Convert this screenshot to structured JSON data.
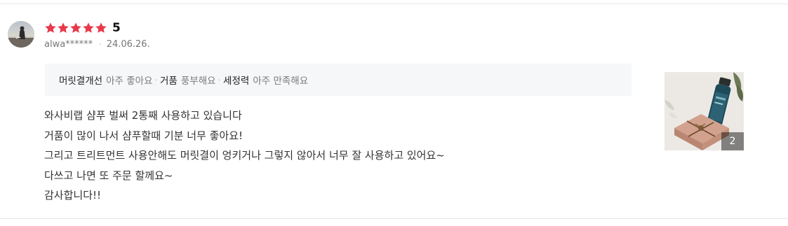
{
  "review": {
    "rating": {
      "stars": 5,
      "value": "5",
      "star_color": "#e8394a"
    },
    "author": {
      "username": "alwa******",
      "avatar": "user-avatar-photo"
    },
    "date": "24.06.26.",
    "meta_separator": "·",
    "survey": [
      {
        "key": "머릿결개선",
        "value": "아주 좋아요"
      },
      {
        "key": "거품",
        "value": "풍부해요"
      },
      {
        "key": "세정력",
        "value": "아주 만족해요"
      }
    ],
    "survey_separator": "·",
    "body_lines": [
      "와사비랩 샴푸 벌써 2통째 사용하고 있습니다",
      "거품이 많이 나서 샴푸할때 기분 너무 좋아요!",
      "그리고 트리트먼트 사용안해도 머릿결이 엉키거나 그렇지 않아서 너무 잘 사용하고 있어요~",
      "다쓰고 나면 또 주문 할께요~",
      "감사합니다!!"
    ],
    "photo": {
      "count": "2"
    }
  },
  "colors": {
    "survey_bg": "#f6f7f9",
    "divider": "#e6e6e6"
  }
}
